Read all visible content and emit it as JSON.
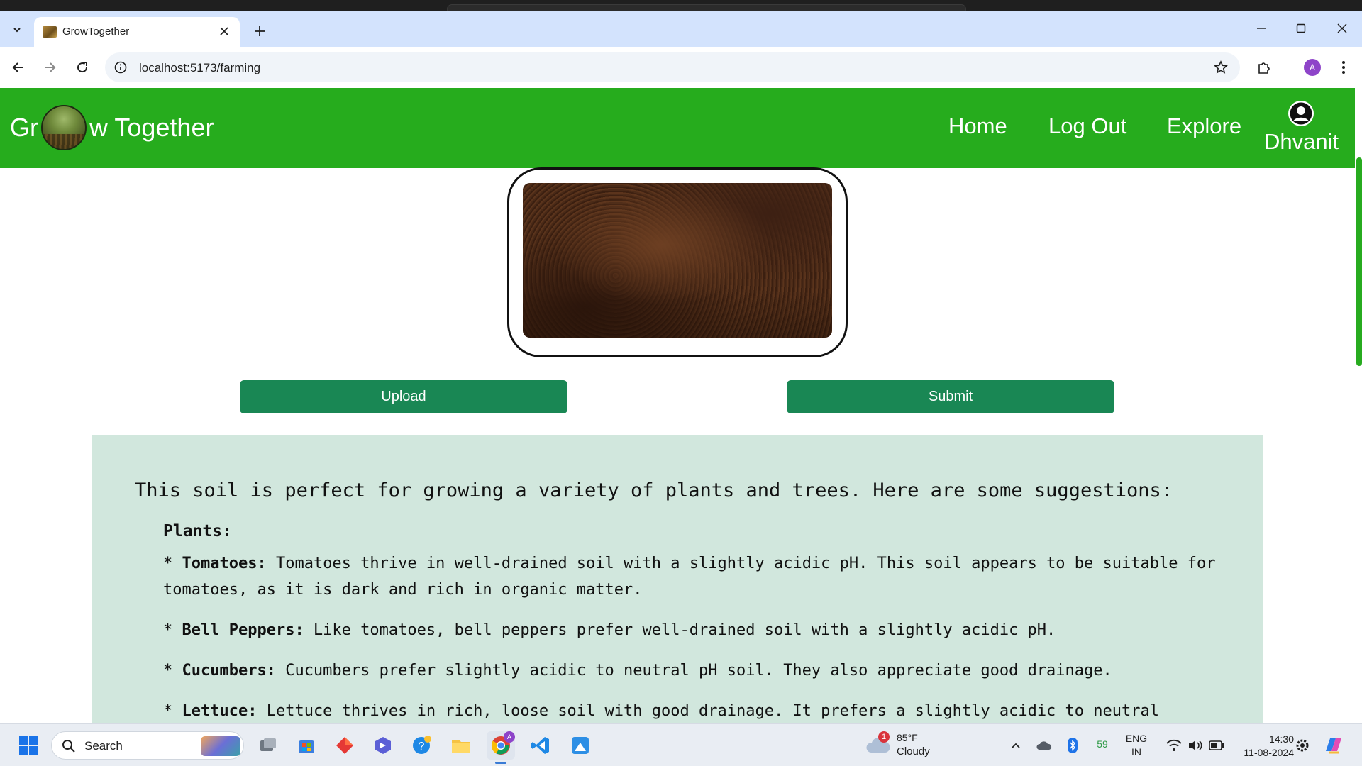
{
  "browser": {
    "tab_title": "GrowTogether",
    "url": "localhost:5173/farming",
    "profile_initial": "A"
  },
  "navbar": {
    "brand_prefix": "Gr",
    "brand_suffix": "w Together",
    "links": [
      "Home",
      "Log Out",
      "Explore"
    ],
    "username": "Dhvanit"
  },
  "actions": {
    "upload_label": "Upload",
    "submit_label": "Submit"
  },
  "result": {
    "intro": "This soil is perfect for growing a variety of plants and trees. Here are some suggestions:",
    "plants_heading": "Plants:",
    "items": [
      {
        "name": "Tomatoes:",
        "text": " Tomatoes thrive in well-drained soil with a slightly acidic pH. This soil appears to be suitable for tomatoes, as it is dark and rich in organic matter."
      },
      {
        "name": "Bell Peppers:",
        "text": " Like tomatoes, bell peppers prefer well-drained soil with a slightly acidic pH."
      },
      {
        "name": "Cucumbers:",
        "text": " Cucumbers prefer slightly acidic to neutral pH soil. They also appreciate good drainage."
      },
      {
        "name": "Lettuce:",
        "text": " Lettuce thrives in rich, loose soil with good drainage. It prefers a slightly acidic to neutral"
      }
    ]
  },
  "taskbar": {
    "search_label": "Search",
    "weather_temp": "85°F",
    "weather_cond": "Cloudy",
    "weather_badge": "1",
    "tray_number": "59",
    "lang_top": "ENG",
    "lang_bottom": "IN",
    "time": "14:30",
    "date": "11-08-2024"
  },
  "colors": {
    "navbar_green": "#26ac1d",
    "button_green": "#198754",
    "result_bg": "#d1e7dd"
  }
}
